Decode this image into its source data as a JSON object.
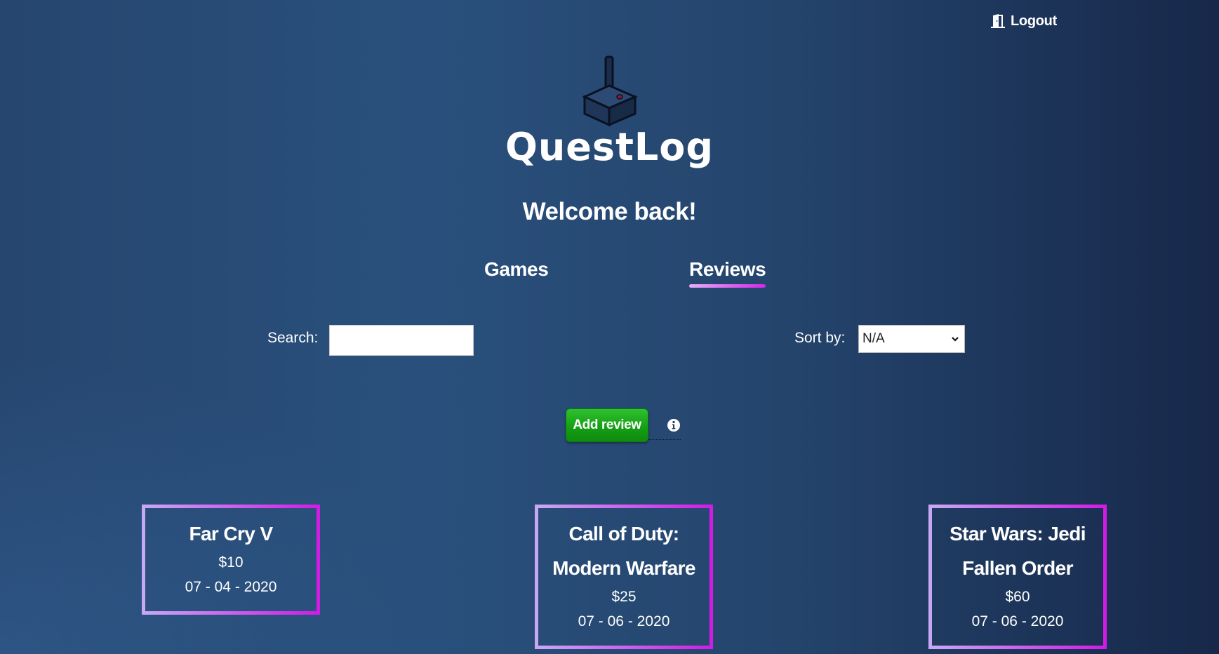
{
  "header": {
    "logout_label": "Logout"
  },
  "brand": {
    "name": "QuestLog"
  },
  "welcome": "Welcome back!",
  "tabs": [
    {
      "label": "Games",
      "active": false
    },
    {
      "label": "Reviews",
      "active": true
    }
  ],
  "search": {
    "label": "Search:",
    "value": "",
    "placeholder": ""
  },
  "sort": {
    "label": "Sort by:",
    "selected": "N/A"
  },
  "actions": {
    "add_review_label": "Add review"
  },
  "reviews": [
    {
      "title": "Far Cry V",
      "price": "$10",
      "date": "07 - 04 - 2020"
    },
    {
      "title": "Call of Duty: Modern Warfare",
      "price": "$25",
      "date": "07 - 06 - 2020"
    },
    {
      "title": "Star Wars: Jedi Fallen Order",
      "price": "$60",
      "date": "07 - 06 - 2020"
    }
  ],
  "colors": {
    "accent_gradient_start": "#c7a8f5",
    "accent_gradient_end": "#d21ce6",
    "button_green": "#15a015",
    "background": "#26466f"
  },
  "icons": {
    "logout": "door-exit-icon",
    "logo": "joystick-icon",
    "info": "info-circle-icon",
    "select": "chevron-down-icon"
  }
}
